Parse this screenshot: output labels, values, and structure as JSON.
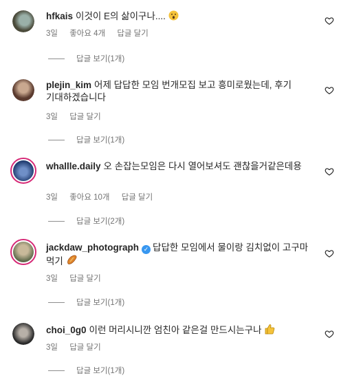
{
  "comments": [
    {
      "username": "hfkais",
      "text": "이것이 E의 삶이구나....",
      "emoji_icon": "astonished-face-icon",
      "time": "3일",
      "likes": "좋아요 4개",
      "reply_action": "답글 달기",
      "view_replies": "답글 보기(1개)",
      "avatar_colors": [
        "#4a4a3a",
        "#9ab0a8"
      ]
    },
    {
      "username": "plejin_kim",
      "text": "어제 답답한 모임 번개모집 보고 흥미로웠는데, 후기 기대하겠습니다",
      "time": "3일",
      "reply_action": "답글 달기",
      "view_replies": "답글 보기(1개)",
      "avatar_colors": [
        "#5a3a2e",
        "#c9a88f"
      ]
    },
    {
      "username": "whallle.daily",
      "text": "오 손잡는모임은 다시 열어보셔도 괜찮을거같은데용",
      "time": "3일",
      "likes": "좋아요 10개",
      "reply_action": "답글 달기",
      "view_replies": "답글 보기(2개)",
      "avatar_colors": [
        "#1e3a6e",
        "#6f8fc7"
      ]
    },
    {
      "username": "jackdaw_photograph",
      "text": "답답한 모임에서 물이랑 김치없이 고구마 먹기",
      "emoji_icon": "sweet-potato-icon",
      "time": "3일",
      "reply_action": "답글 달기",
      "view_replies": "답글 보기(1개)",
      "avatar_colors": [
        "#5e6a4c",
        "#c8b99a"
      ]
    },
    {
      "username": "choi_0g0",
      "text": "이런 머리시니깐 엄친아 같은걸 만드시는구나",
      "emoji_icon": "thumbs-up-icon",
      "time": "3일",
      "reply_action": "답글 달기",
      "view_replies": "답글 보기(1개)",
      "avatar_colors": [
        "#2a2a2a",
        "#b7b0a8"
      ]
    }
  ],
  "colors": {
    "text": "#262626",
    "secondary": "#737373",
    "verified": "#3897f0",
    "story_ring": "#d62976"
  }
}
